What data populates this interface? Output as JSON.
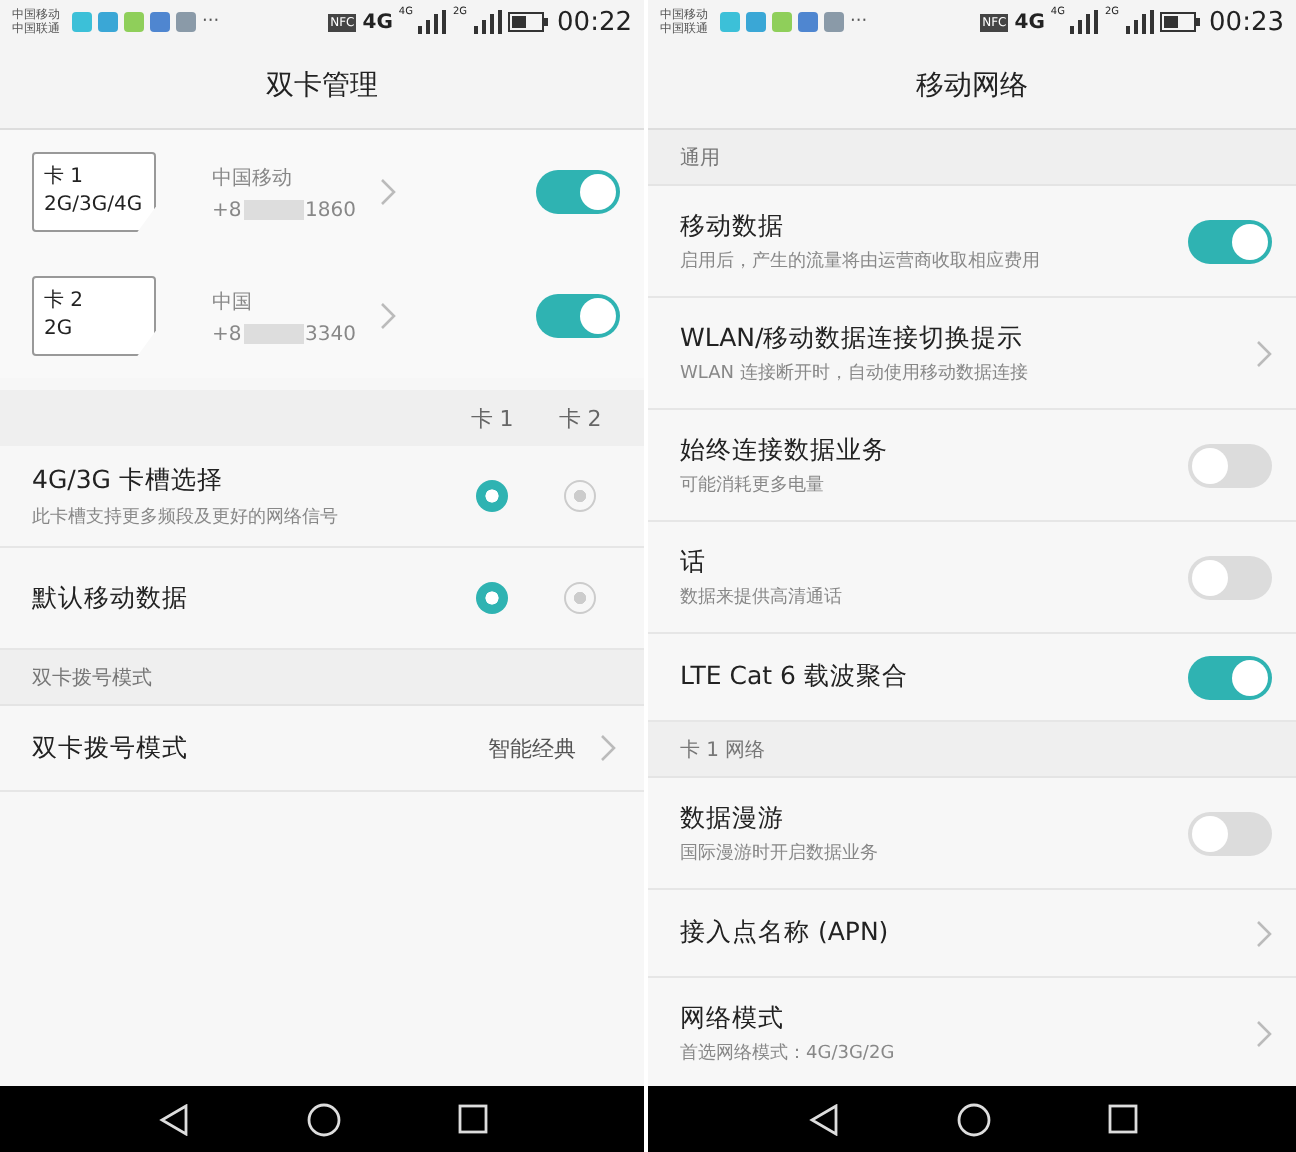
{
  "left_screen": {
    "status_bar": {
      "carriers": [
        "中国移动",
        "中国联通"
      ],
      "more": "···",
      "nfc": "NFC",
      "network": "4G",
      "signal_labels": [
        "4G",
        "2G"
      ],
      "time": "00:22"
    },
    "title": "双卡管理",
    "sims": [
      {
        "name": "卡 1",
        "bands": "2G/3G/4G",
        "carrier": "中国移动",
        "number_start": "+8",
        "number_end": "1860",
        "on": true
      },
      {
        "name": "卡 2",
        "bands": "2G",
        "carrier": "中国",
        "number_start": "+8",
        "number_end": "3340",
        "on": true
      }
    ],
    "radio_columns": [
      "卡 1",
      "卡 2"
    ],
    "radio_rows": [
      {
        "title": "4G/3G 卡槽选择",
        "subtitle": "此卡槽支持更多频段及更好的网络信号",
        "choices": [
          {
            "selected": true
          },
          {
            "selected": false
          }
        ]
      },
      {
        "title": "默认移动数据",
        "choices": [
          {
            "selected": true
          },
          {
            "selected": false
          }
        ]
      }
    ],
    "section": "双卡拨号模式",
    "dial_row": {
      "title": "双卡拨号模式",
      "value": "智能经典"
    }
  },
  "right_screen": {
    "status_bar": {
      "carriers": [
        "中国移动",
        "中国联通"
      ],
      "more": "···",
      "nfc": "NFC",
      "network": "4G",
      "signal_labels": [
        "4G",
        "2G"
      ],
      "time": "00:23"
    },
    "title": "移动网络",
    "items": [
      {
        "kind": "section",
        "title": "通用"
      },
      {
        "kind": "toggle",
        "title": "移动数据",
        "subtitle": "启用后，产生的流量将由运营商收取相应费用",
        "on": true
      },
      {
        "kind": "link",
        "title": "WLAN/移动数据连接切换提示",
        "subtitle": "WLAN 连接断开时，自动使用移动数据连接"
      },
      {
        "kind": "toggle",
        "title": "始终连接数据业务",
        "subtitle": "可能消耗更多电量",
        "on": false
      },
      {
        "kind": "toggle",
        "title": "话",
        "subtitle": "数据来提供高清通话",
        "on": false
      },
      {
        "kind": "toggle",
        "title": "LTE Cat 6 载波聚合",
        "on": true
      },
      {
        "kind": "section",
        "title": "卡 1 网络"
      },
      {
        "kind": "toggle",
        "title": "数据漫游",
        "subtitle": "国际漫游时开启数据业务",
        "on": false
      },
      {
        "kind": "link",
        "title": "接入点名称 (APN)"
      },
      {
        "kind": "link",
        "title": "网络模式",
        "subtitle": "首选网络模式：4G/3G/2G"
      }
    ]
  }
}
